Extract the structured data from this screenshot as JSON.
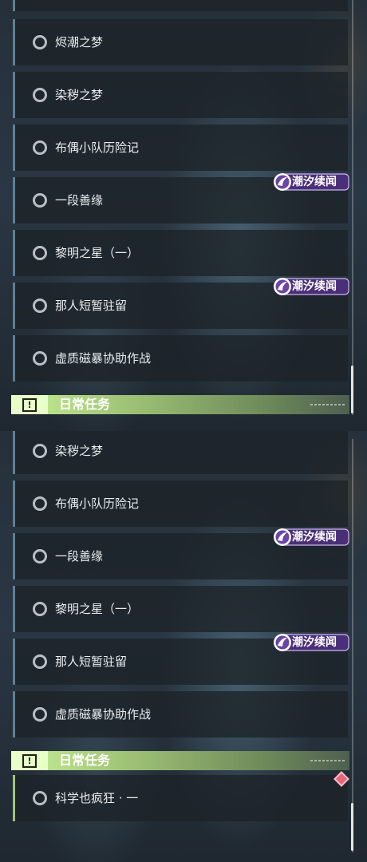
{
  "top": {
    "quests": [
      {
        "label": "烬潮之梦"
      },
      {
        "label": "染秽之梦"
      },
      {
        "label": "布偶小队历险记"
      },
      {
        "label": "一段善缘"
      },
      {
        "label": "黎明之星（一）"
      },
      {
        "label": "那人短暂驻留"
      },
      {
        "label": "虚质磁暴协助作战"
      }
    ],
    "badges": [
      "潮汐续闻",
      "潮汐续闻"
    ],
    "section_header": "日常任务"
  },
  "bottom": {
    "quests": [
      {
        "label": "染秽之梦"
      },
      {
        "label": "布偶小队历险记"
      },
      {
        "label": "一段善缘"
      },
      {
        "label": "黎明之星（一）"
      },
      {
        "label": "那人短暂驻留"
      },
      {
        "label": "虚质磁暴协助作战"
      }
    ],
    "badges": [
      "潮汐续闻",
      "潮汐续闻"
    ],
    "section_header": "日常任务",
    "daily_quests": [
      {
        "label": "科学也疯狂 · 一"
      }
    ]
  },
  "icons": {
    "status": "empty-circle-icon",
    "badge": "tide-moon-icon",
    "section": "exclamation-box-icon",
    "marker": "red-diamond-icon"
  },
  "colors": {
    "accent_blue": "#5d7f96",
    "accent_green": "#9fc37a",
    "badge_purple": "#5a3a8c",
    "marker_red": "#e9657a"
  }
}
